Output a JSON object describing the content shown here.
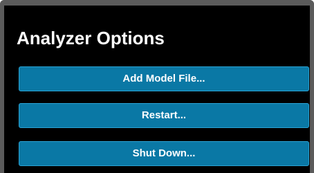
{
  "panel": {
    "title": "Analyzer Options",
    "buttons": [
      {
        "label": "Add Model File..."
      },
      {
        "label": "Restart..."
      },
      {
        "label": "Shut Down..."
      }
    ]
  },
  "colors": {
    "background": "#000000",
    "frame": "#5b5b5b",
    "button_fill": "#0a78a5",
    "button_border": "#2aa3d4",
    "text": "#ffffff"
  }
}
